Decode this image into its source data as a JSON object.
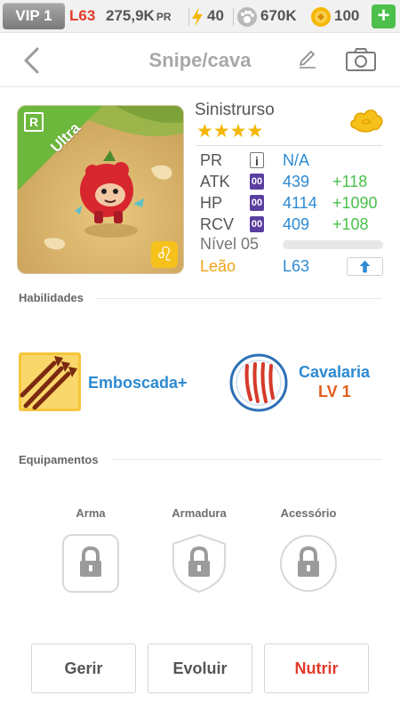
{
  "status_bar": {
    "vip": "VIP 1",
    "level": "L63",
    "power": "275,9K",
    "power_unit": "PR",
    "energy": "40",
    "coins": "670K",
    "gems": "100",
    "add_label": "+"
  },
  "nav": {
    "title": "Snipe/cava"
  },
  "hero": {
    "name": "Sinistrurso",
    "rarity": "Ultra",
    "rarity_badge": "R",
    "stars": "★★★★",
    "zodiac_symbol": "♌",
    "stats": [
      {
        "label": "PR",
        "icon": "i",
        "value": "N/A",
        "bonus": ""
      },
      {
        "label": "ATK",
        "icon": "00",
        "value": "439",
        "bonus": "+118"
      },
      {
        "label": "HP",
        "icon": "00",
        "value": "4114",
        "bonus": "+1090"
      },
      {
        "label": "RCV",
        "icon": "00",
        "value": "409",
        "bonus": "+108"
      }
    ],
    "level_label": "Nível 05",
    "xp_progress": 0,
    "zodiac": "Leão",
    "level_cap": "L63"
  },
  "skills": {
    "title": "Habilidades",
    "items": [
      {
        "name": "Emboscada+",
        "level": ""
      },
      {
        "name": "Cavalaria",
        "level": "LV 1"
      }
    ]
  },
  "equipment": {
    "title": "Equipamentos",
    "slots": [
      "Arma",
      "Armadura",
      "Acessório"
    ]
  },
  "actions": {
    "manage": "Gerir",
    "evolve": "Evoluir",
    "feed": "Nutrir"
  },
  "colors": {
    "accent_blue": "#2d8ad1",
    "bonus_green": "#49c04a",
    "zodiac_orange": "#f2a317",
    "alert_red": "#e23b2a",
    "rarity_green": "#6cb83c"
  }
}
